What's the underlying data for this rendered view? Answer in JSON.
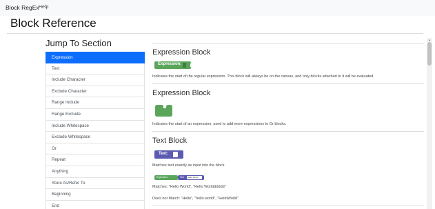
{
  "navbar": {
    "brand": "Block RegEx",
    "help": "Help"
  },
  "page": {
    "title": "Block Reference"
  },
  "sidebar": {
    "heading": "Jump To Section",
    "items": [
      {
        "label": "Expression",
        "active": true
      },
      {
        "label": "Text",
        "active": false
      },
      {
        "label": "Include Character",
        "active": false
      },
      {
        "label": "Exclude Character",
        "active": false
      },
      {
        "label": "Range Include",
        "active": false
      },
      {
        "label": "Range Exclude",
        "active": false
      },
      {
        "label": "Include Whitespace",
        "active": false
      },
      {
        "label": "Exclude Whitespace",
        "active": false
      },
      {
        "label": "Or",
        "active": false
      },
      {
        "label": "Repeat",
        "active": false
      },
      {
        "label": "Anything",
        "active": false
      },
      {
        "label": "Store As/Refer To",
        "active": false
      },
      {
        "label": "Beginning",
        "active": false
      },
      {
        "label": "End",
        "active": false
      }
    ]
  },
  "sections": {
    "expression": {
      "title": "Expression Block",
      "block_label": "Expression:",
      "description": "Indicates the start of the regular expression. This block will always be on the canvas, and only blocks attached to it will be evaluated."
    },
    "or_expression": {
      "title": "Expression Block",
      "description": "Indicates the start of an expression, used to add more expressions to Or blocks."
    },
    "text": {
      "title": "Text Block",
      "block_label": "Text:",
      "description": "Matches text exactly as input into the block",
      "example_expression_label": "Expression:",
      "example_text_label": "Text",
      "example_text_value": "Hello World",
      "matches": "Matches: \"Hello World\", \"Hello Worldddddd\"",
      "does_not_match": "Does not Match: \"Hello\", \"hello world\", \"HelloWorld\""
    }
  },
  "colors": {
    "active": "#0d6efd",
    "expression_block": "#5ba55b",
    "text_block": "#5b5bb0"
  }
}
